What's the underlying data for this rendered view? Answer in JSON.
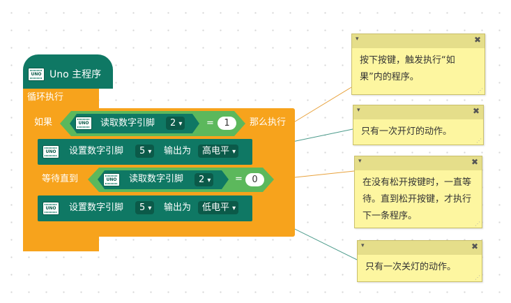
{
  "program": {
    "hat_label": "Uno 主程序",
    "board_icon_label": "UNO",
    "loop_label": "循环执行",
    "if_block": {
      "if_label": "如果",
      "read_label": "读取数字引脚",
      "pin": "2",
      "operator": "=",
      "value": "1",
      "then_label": "那么执行"
    },
    "set_high": {
      "label": "设置数字引脚",
      "pin": "5",
      "output_label": "输出为",
      "level": "高电平"
    },
    "wait_until": {
      "label": "等待直到",
      "read_label": "读取数字引脚",
      "pin": "2",
      "operator": "=",
      "value": "0"
    },
    "set_low": {
      "label": "设置数字引脚",
      "pin": "5",
      "output_label": "输出为",
      "level": "低电平"
    }
  },
  "comments": [
    {
      "text": "按下按键，触发执行“如果”内的程序。"
    },
    {
      "text": "只有一次开灯的动作。"
    },
    {
      "text": "在没有松开按键时，一直等待。直到松开按键，才执行下一条程序。"
    },
    {
      "text": "只有一次关灯的动作。"
    }
  ],
  "icons": {
    "dropdown": "▾",
    "collapse": "▾",
    "close": "✖",
    "resize": "⋰"
  },
  "colors": {
    "control_orange": "#f7a31c",
    "uno_green": "#0f7864",
    "logic_green": "#5cb85c",
    "comment_yellow": "#fdf6a0"
  }
}
